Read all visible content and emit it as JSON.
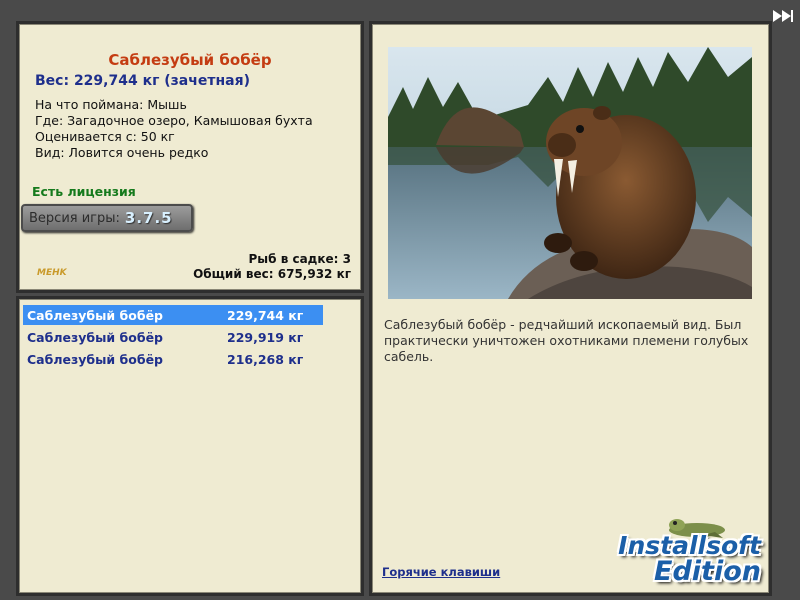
{
  "fish": {
    "title": "Саблезубый бобёр",
    "weight": "Вес: 229,744 кг (зачетная)",
    "caught_on": "На что поймана: Мышь",
    "location": "Где: Загадочное озеро, Камышовая бухта",
    "value": "Оценивается с: 50 кг",
    "rarity": "Вид: Ловится очень редко"
  },
  "license": "Есть лицензия",
  "version": {
    "label": "Версия игры:",
    "number": "3.7.5"
  },
  "logo_text": "MEHK",
  "stats": {
    "fish_count": "Рыб в садке: 3",
    "total_weight": "Общий вес: 675,932 кг"
  },
  "catch_list": [
    {
      "name": "Саблезубый бобёр",
      "weight": "229,744 кг",
      "selected": true
    },
    {
      "name": "Саблезубый бобёр",
      "weight": "229,919 кг",
      "selected": false
    },
    {
      "name": "Саблезубый бобёр",
      "weight": "216,268 кг",
      "selected": false
    }
  ],
  "description": "Саблезубый бобёр - редчайший ископаемый вид. Был практически уничтожен охотниками племени голубых сабель.",
  "hotkeys_link": "Горячие клавиши",
  "watermark": {
    "line1": "Installsoft",
    "line2": "Edition"
  },
  "icons": {
    "fast_forward": "fast-forward-icon",
    "photo": "beaver-photo"
  },
  "colors": {
    "title": "#c43c12",
    "accent": "#1e2f8c",
    "license": "#157a1c",
    "selection": "#3c8ff2"
  }
}
